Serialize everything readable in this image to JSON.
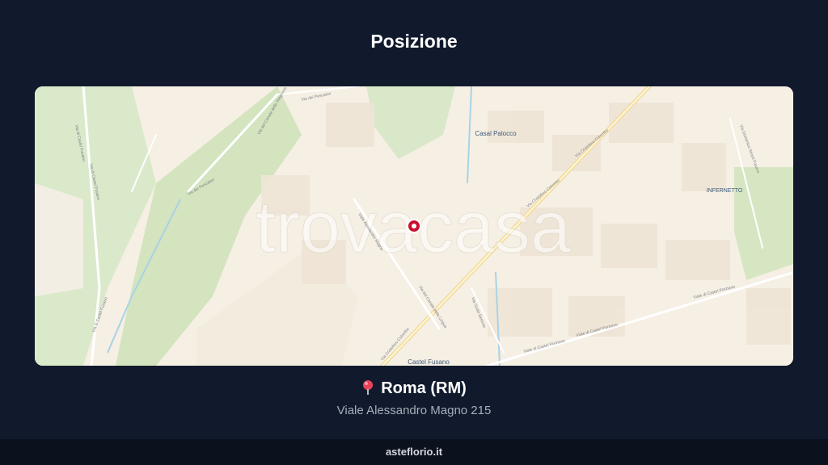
{
  "header": {
    "title": "Posizione"
  },
  "map": {
    "labels": {
      "casal_palocco": "Casal Palocco",
      "infernetto": "INFERNETTO",
      "castel_fusano": "Castel Fusano",
      "via_dei_pescatori": "Via dei Pescatori",
      "via_dei_pescatori_2": "Via dei Pescatori",
      "via_canale_dello_stagnone": "Via del Canale dello Stagnone",
      "via_castel_fusano": "Via di Castel Fusano",
      "via_castel_fusano_2": "Via di Castel Fusano",
      "via_castel_fusano_3": "Via di Castel Fusano",
      "via_alessandro_magno": "Viale Alessandro Magno",
      "via_canale_della_lingua": "Via del Canale della Lingua",
      "via_cristoforo_colombo": "Via Cristoforo Colombo",
      "via_cristoforo_colombo_2": "Via Cristoforo Colombo",
      "via_cristoforo_colombo_3": "Via Cristoforo Colombo",
      "via_giulio_bertone": "Via Giulio Bertone",
      "via_castel_porziano": "Viale di Castel Porziano",
      "via_castel_porziano_2": "Viale di Castel Porziano",
      "via_castel_porziano_3": "Viale di Castel Porziano",
      "via_torcegno": "Via Domenico Stranl Fusano"
    },
    "watermark": "trovacasa",
    "marker_icon": "map-marker-icon"
  },
  "location": {
    "pin_icon": "round-pushpin-icon",
    "city": "Roma (RM)",
    "address": "Viale Alessandro Magno 215"
  },
  "footer": {
    "site": "asteflorio.it"
  },
  "colors": {
    "background": "#111a2c",
    "map_land": "#f6efe4",
    "map_green": "#d8e8c6",
    "marker": "#c8102e"
  }
}
